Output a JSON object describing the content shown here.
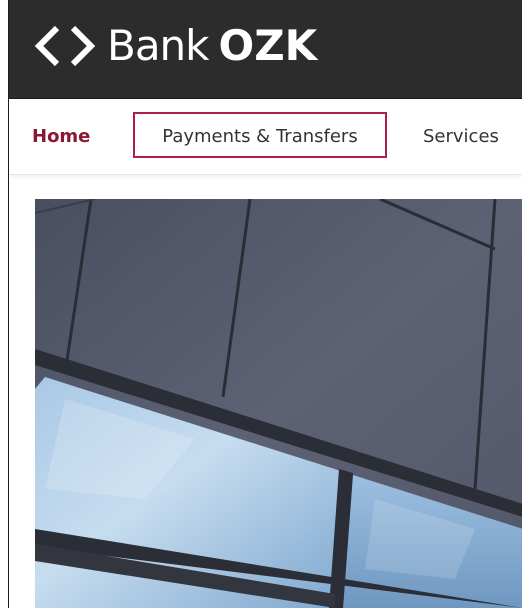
{
  "header": {
    "logo_icon": "chevrons-diamond-icon",
    "logo_word_light": "Bank",
    "logo_word_bold": "OZK"
  },
  "nav": {
    "items": [
      {
        "label": "Home",
        "active": true
      },
      {
        "label": "Payments & Transfers",
        "highlighted": true
      },
      {
        "label": "Services"
      }
    ]
  },
  "hero": {
    "image_subject": "building-facade-image"
  },
  "colors": {
    "header_bg": "#2c2c2c",
    "brand_red": "#8a1733",
    "highlight_border": "#b01e48",
    "text": "#333333"
  }
}
